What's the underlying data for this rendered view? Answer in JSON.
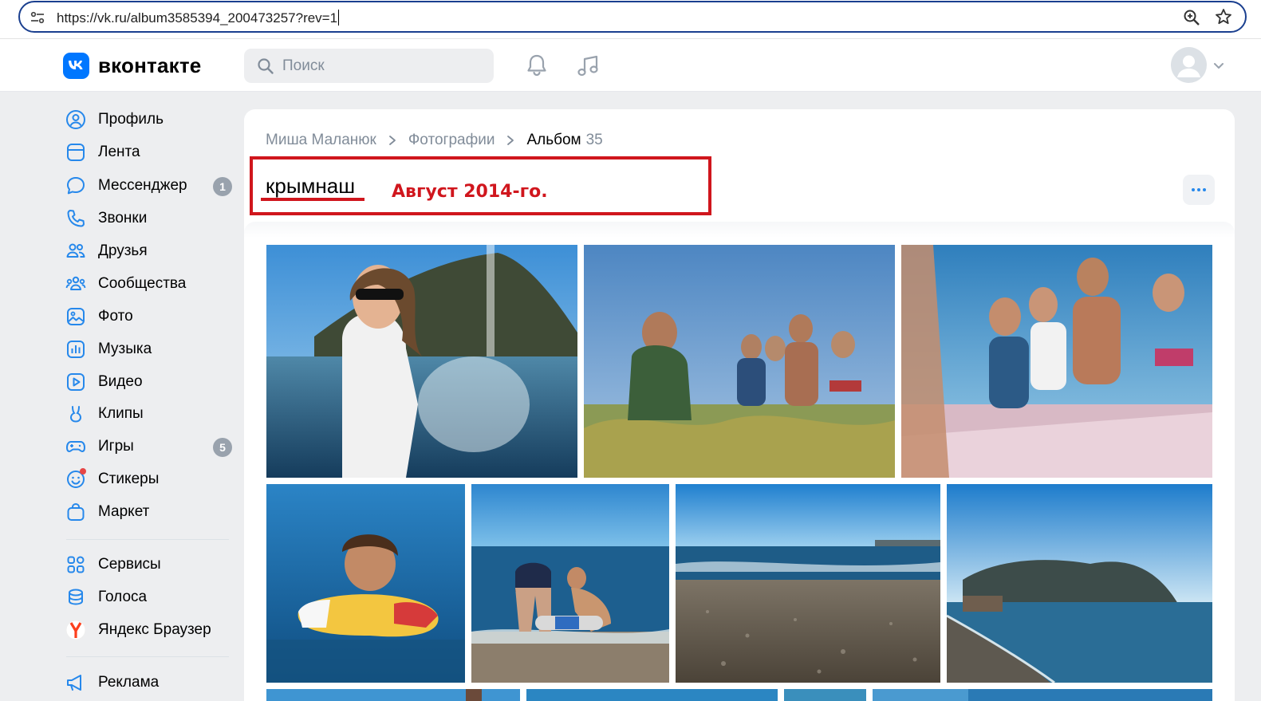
{
  "browser": {
    "url": "https://vk.ru/album3585394_200473257?rev=1"
  },
  "header": {
    "brand": "вконтакте",
    "search_placeholder": "Поиск"
  },
  "sidebar": {
    "items": [
      {
        "label": "Профиль",
        "icon": "profile-icon"
      },
      {
        "label": "Лента",
        "icon": "feed-icon"
      },
      {
        "label": "Мессенджер",
        "icon": "messenger-icon",
        "badge": "1"
      },
      {
        "label": "Звонки",
        "icon": "phone-icon"
      },
      {
        "label": "Друзья",
        "icon": "friends-icon"
      },
      {
        "label": "Сообщества",
        "icon": "communities-icon"
      },
      {
        "label": "Фото",
        "icon": "photo-icon"
      },
      {
        "label": "Музыка",
        "icon": "music-icon"
      },
      {
        "label": "Видео",
        "icon": "video-icon"
      },
      {
        "label": "Клипы",
        "icon": "clips-icon"
      },
      {
        "label": "Игры",
        "icon": "games-icon",
        "badge": "5"
      },
      {
        "label": "Стикеры",
        "icon": "stickers-icon"
      },
      {
        "label": "Маркет",
        "icon": "market-icon"
      }
    ],
    "items2": [
      {
        "label": "Сервисы",
        "icon": "services-icon"
      },
      {
        "label": "Голоса",
        "icon": "votes-icon"
      },
      {
        "label": "Яндекс Браузер",
        "icon": "yandex-browser-icon"
      }
    ],
    "items3": [
      {
        "label": "Реклама",
        "icon": "ads-icon"
      }
    ]
  },
  "breadcrumb": {
    "owner": "Миша Маланюк",
    "section": "Фотографии",
    "current": "Альбом",
    "count": "35"
  },
  "album": {
    "title": "крымнаш",
    "annotation": "Август 2014-го."
  },
  "colors": {
    "accent": "#0077ff",
    "annotation": "#d0161d",
    "badge": "#99a2ad"
  }
}
